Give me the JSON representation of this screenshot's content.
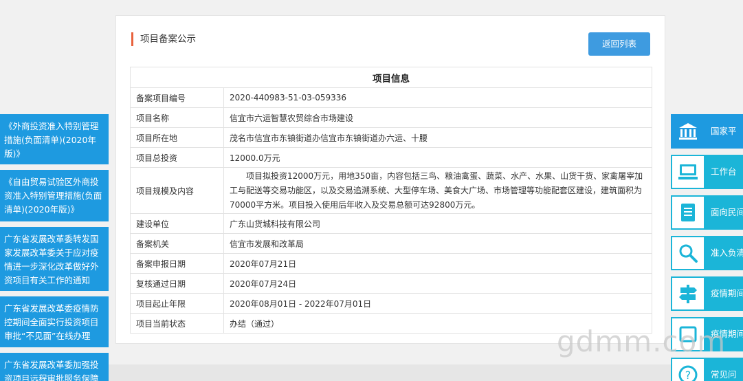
{
  "card": {
    "title": "项目备案公示",
    "back_label": "返回列表"
  },
  "table": {
    "header": "项目信息",
    "rows": [
      {
        "label": "备案项目编号",
        "value": "2020-440983-51-03-059336"
      },
      {
        "label": "项目名称",
        "value": "信宜市六运智慧农贸综合市场建设"
      },
      {
        "label": "项目所在地",
        "value": "茂名市信宜市东镇街道办信宜市东镇街道办六运、十腰"
      },
      {
        "label": "项目总投资",
        "value": "12000.0万元"
      },
      {
        "label": "项目规模及内容",
        "value": "项目拟投资12000万元，用地350亩，内容包括三鸟、粮油禽蛋、蔬菜、水产、水果、山货干货、家禽屠宰加工与配送等交易功能区，以及交易追溯系统、大型停车场、美食大广场、市场管理等功能配套区建设，建筑面积为70000平方米。项目投入使用后年收入及交易总额可达92800万元。"
      },
      {
        "label": "建设单位",
        "value": "广东山货城科技有限公司"
      },
      {
        "label": "备案机关",
        "value": "信宜市发展和改革局"
      },
      {
        "label": "备案申报日期",
        "value": "2020年07月21日"
      },
      {
        "label": "复核通过日期",
        "value": "2020年07月24日"
      },
      {
        "label": "项目起止年限",
        "value": "2020年08月01日 - 2022年07月01日"
      },
      {
        "label": "项目当前状态",
        "value": "办结（通过）"
      }
    ]
  },
  "left_links": [
    "《外商投资准入特别管理措施(负面清单)(2020年版)》",
    "《自由贸易试验区外商投资准入特别管理措施(负面清单)(2020年版)》",
    "广东省发展改革委转发国家发展改革委关于应对疫情进一步深化改革做好外资项目有关工作的通知",
    "广东省发展改革委疫情防控期间全面实行投资项目审批“不见面”在线办理",
    "广东省发展改革委加强投资项目远程审批服务保障"
  ],
  "right_links": [
    {
      "label": "国家平",
      "icon": "government-building-icon"
    },
    {
      "label": "工作台",
      "icon": "computer-icon"
    },
    {
      "label": "面向民间推介项",
      "icon": "document-list-icon"
    },
    {
      "label": "准入负清单查",
      "icon": "search-icon"
    },
    {
      "label": "疫情期间操作指",
      "icon": "signpost-icon"
    },
    {
      "label": "疫情期间操作指引",
      "icon": "guide-icon"
    },
    {
      "label": "常见问",
      "icon": "question-icon"
    }
  ],
  "watermark": "gdmm.com",
  "colors": {
    "accent_blue": "#1e9ae0",
    "button_blue": "#3e9be0",
    "teal": "#1bb5d8",
    "title_marker": "#e8623d"
  }
}
